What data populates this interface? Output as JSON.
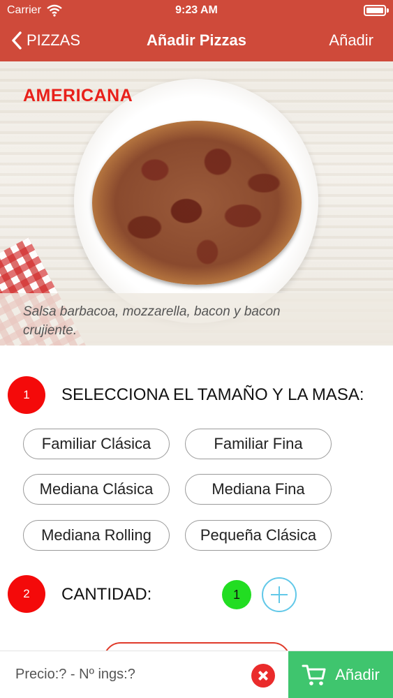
{
  "status_bar": {
    "carrier": "Carrier",
    "time": "9:23 AM",
    "icons": [
      "wifi-icon",
      "battery-icon"
    ]
  },
  "nav": {
    "back_label": "PIZZAS",
    "title": "Añadir Pizzas",
    "action_label": "Añadir",
    "bar_color": "#cf4a3a"
  },
  "pizza": {
    "name": "AMERICANA",
    "name_color": "#e8201a",
    "description": "Salsa barbacoa, mozzarella, bacon y bacon crujiente."
  },
  "step1": {
    "number": "1",
    "heading": "SELECCIONA EL TAMAÑO Y LA MASA:",
    "options": [
      "Familiar Clásica",
      "Familiar Fina",
      "Mediana Clásica",
      "Mediana Fina",
      "Mediana Rolling",
      "Pequeña Clásica"
    ]
  },
  "step2": {
    "number": "2",
    "heading": "CANTIDAD:",
    "quantity": "1",
    "quantity_color": "#22dd22",
    "increment_icon": "plus-icon"
  },
  "footer": {
    "price_summary": "Precio:? - Nº ings:?",
    "clear_icon": "close-icon",
    "add_label": "Añadir",
    "add_color": "#3fc56e",
    "add_icon": "cart-icon"
  },
  "colors": {
    "step_badge": "#f40a0a"
  }
}
